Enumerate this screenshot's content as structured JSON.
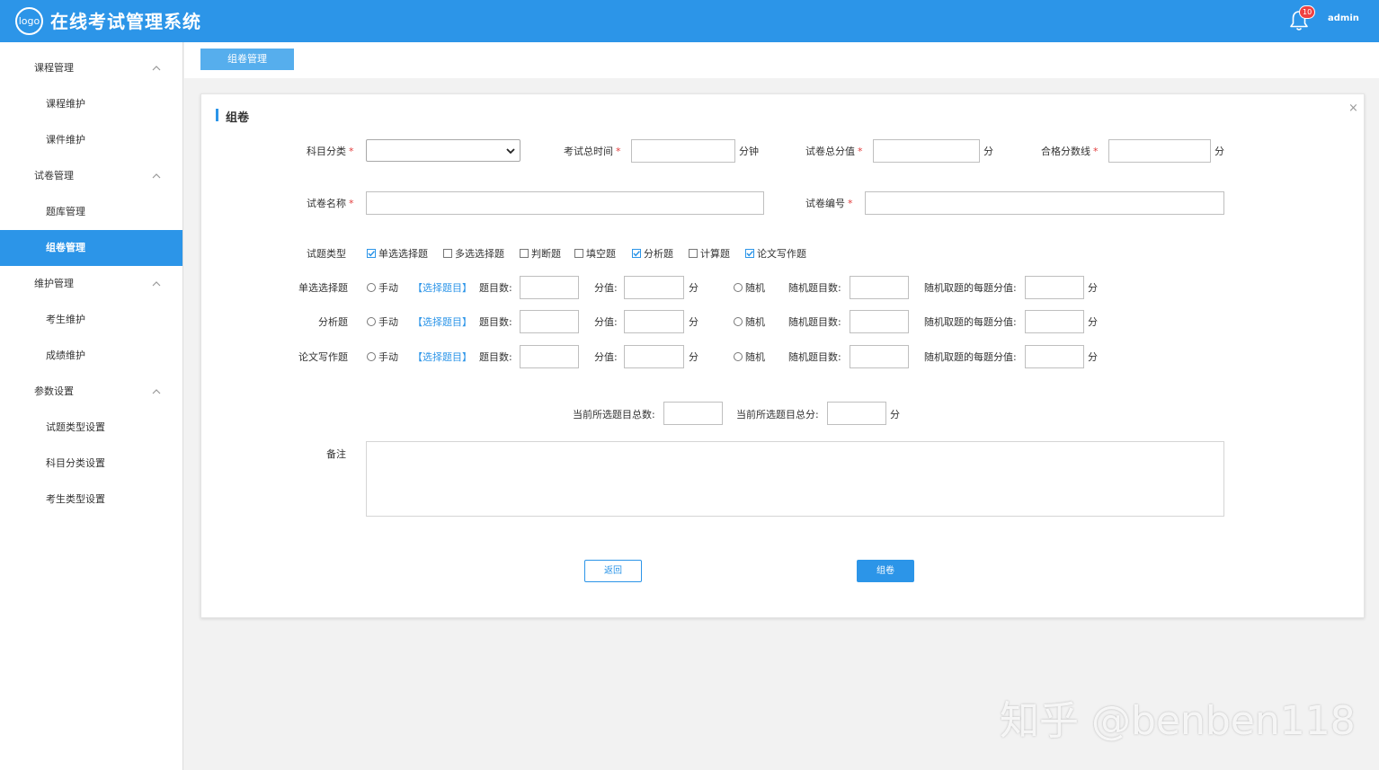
{
  "header": {
    "logo_text": "logo",
    "title": "在线考试管理系统",
    "notification_count": "10",
    "username": "admin"
  },
  "sidebar": {
    "groups": [
      {
        "label": "课程管理",
        "items": [
          "课程维护",
          "课件维护"
        ]
      },
      {
        "label": "试卷管理",
        "items": [
          "题库管理",
          "组卷管理"
        ]
      },
      {
        "label": "维护管理",
        "items": [
          "考生维护",
          "成绩维护"
        ]
      },
      {
        "label": "参数设置",
        "items": [
          "试题类型设置",
          "科目分类设置",
          "考生类型设置"
        ]
      }
    ],
    "active_item": "组卷管理"
  },
  "tabs": {
    "active": "组卷管理"
  },
  "card": {
    "title": "组卷",
    "fields": {
      "subject_category": {
        "label": "科目分类",
        "value": ""
      },
      "exam_duration": {
        "label": "考试总时间",
        "value": "",
        "unit": "分钟"
      },
      "total_score": {
        "label": "试卷总分值",
        "value": "",
        "unit": "分"
      },
      "pass_score": {
        "label": "合格分数线",
        "value": "",
        "unit": "分"
      },
      "paper_name": {
        "label": "试卷名称",
        "value": ""
      },
      "paper_code": {
        "label": "试卷编号",
        "value": ""
      }
    },
    "question_types": {
      "label": "试题类型",
      "options": [
        {
          "label": "单选选择题",
          "checked": true
        },
        {
          "label": "多选选择题",
          "checked": false
        },
        {
          "label": "判断题",
          "checked": false
        },
        {
          "label": "填空题",
          "checked": false
        },
        {
          "label": "分析题",
          "checked": true
        },
        {
          "label": "计算题",
          "checked": false
        },
        {
          "label": "论文写作题",
          "checked": true
        }
      ]
    },
    "selection_rows": [
      {
        "type": "单选选择题"
      },
      {
        "type": "分析题"
      },
      {
        "type": "论文写作题"
      }
    ],
    "row_labels": {
      "manual": "手动",
      "select_link": "【选择题目】",
      "question_count": "题目数:",
      "score": "分值:",
      "unit": "分",
      "random": "随机",
      "random_count": "随机题目数:",
      "random_score": "随机取题的每题分值:"
    },
    "summary": {
      "total_count_label": "当前所选题目总数:",
      "total_score_label": "当前所选题目总分:",
      "unit": "分"
    },
    "remark": {
      "label": "备注",
      "value": ""
    },
    "buttons": {
      "back": "返回",
      "submit": "组卷"
    }
  },
  "watermark": "知乎 @benben118",
  "colors": {
    "primary": "#2c95e8",
    "active_nav": "#2c95e8",
    "badge": "#f04141"
  }
}
